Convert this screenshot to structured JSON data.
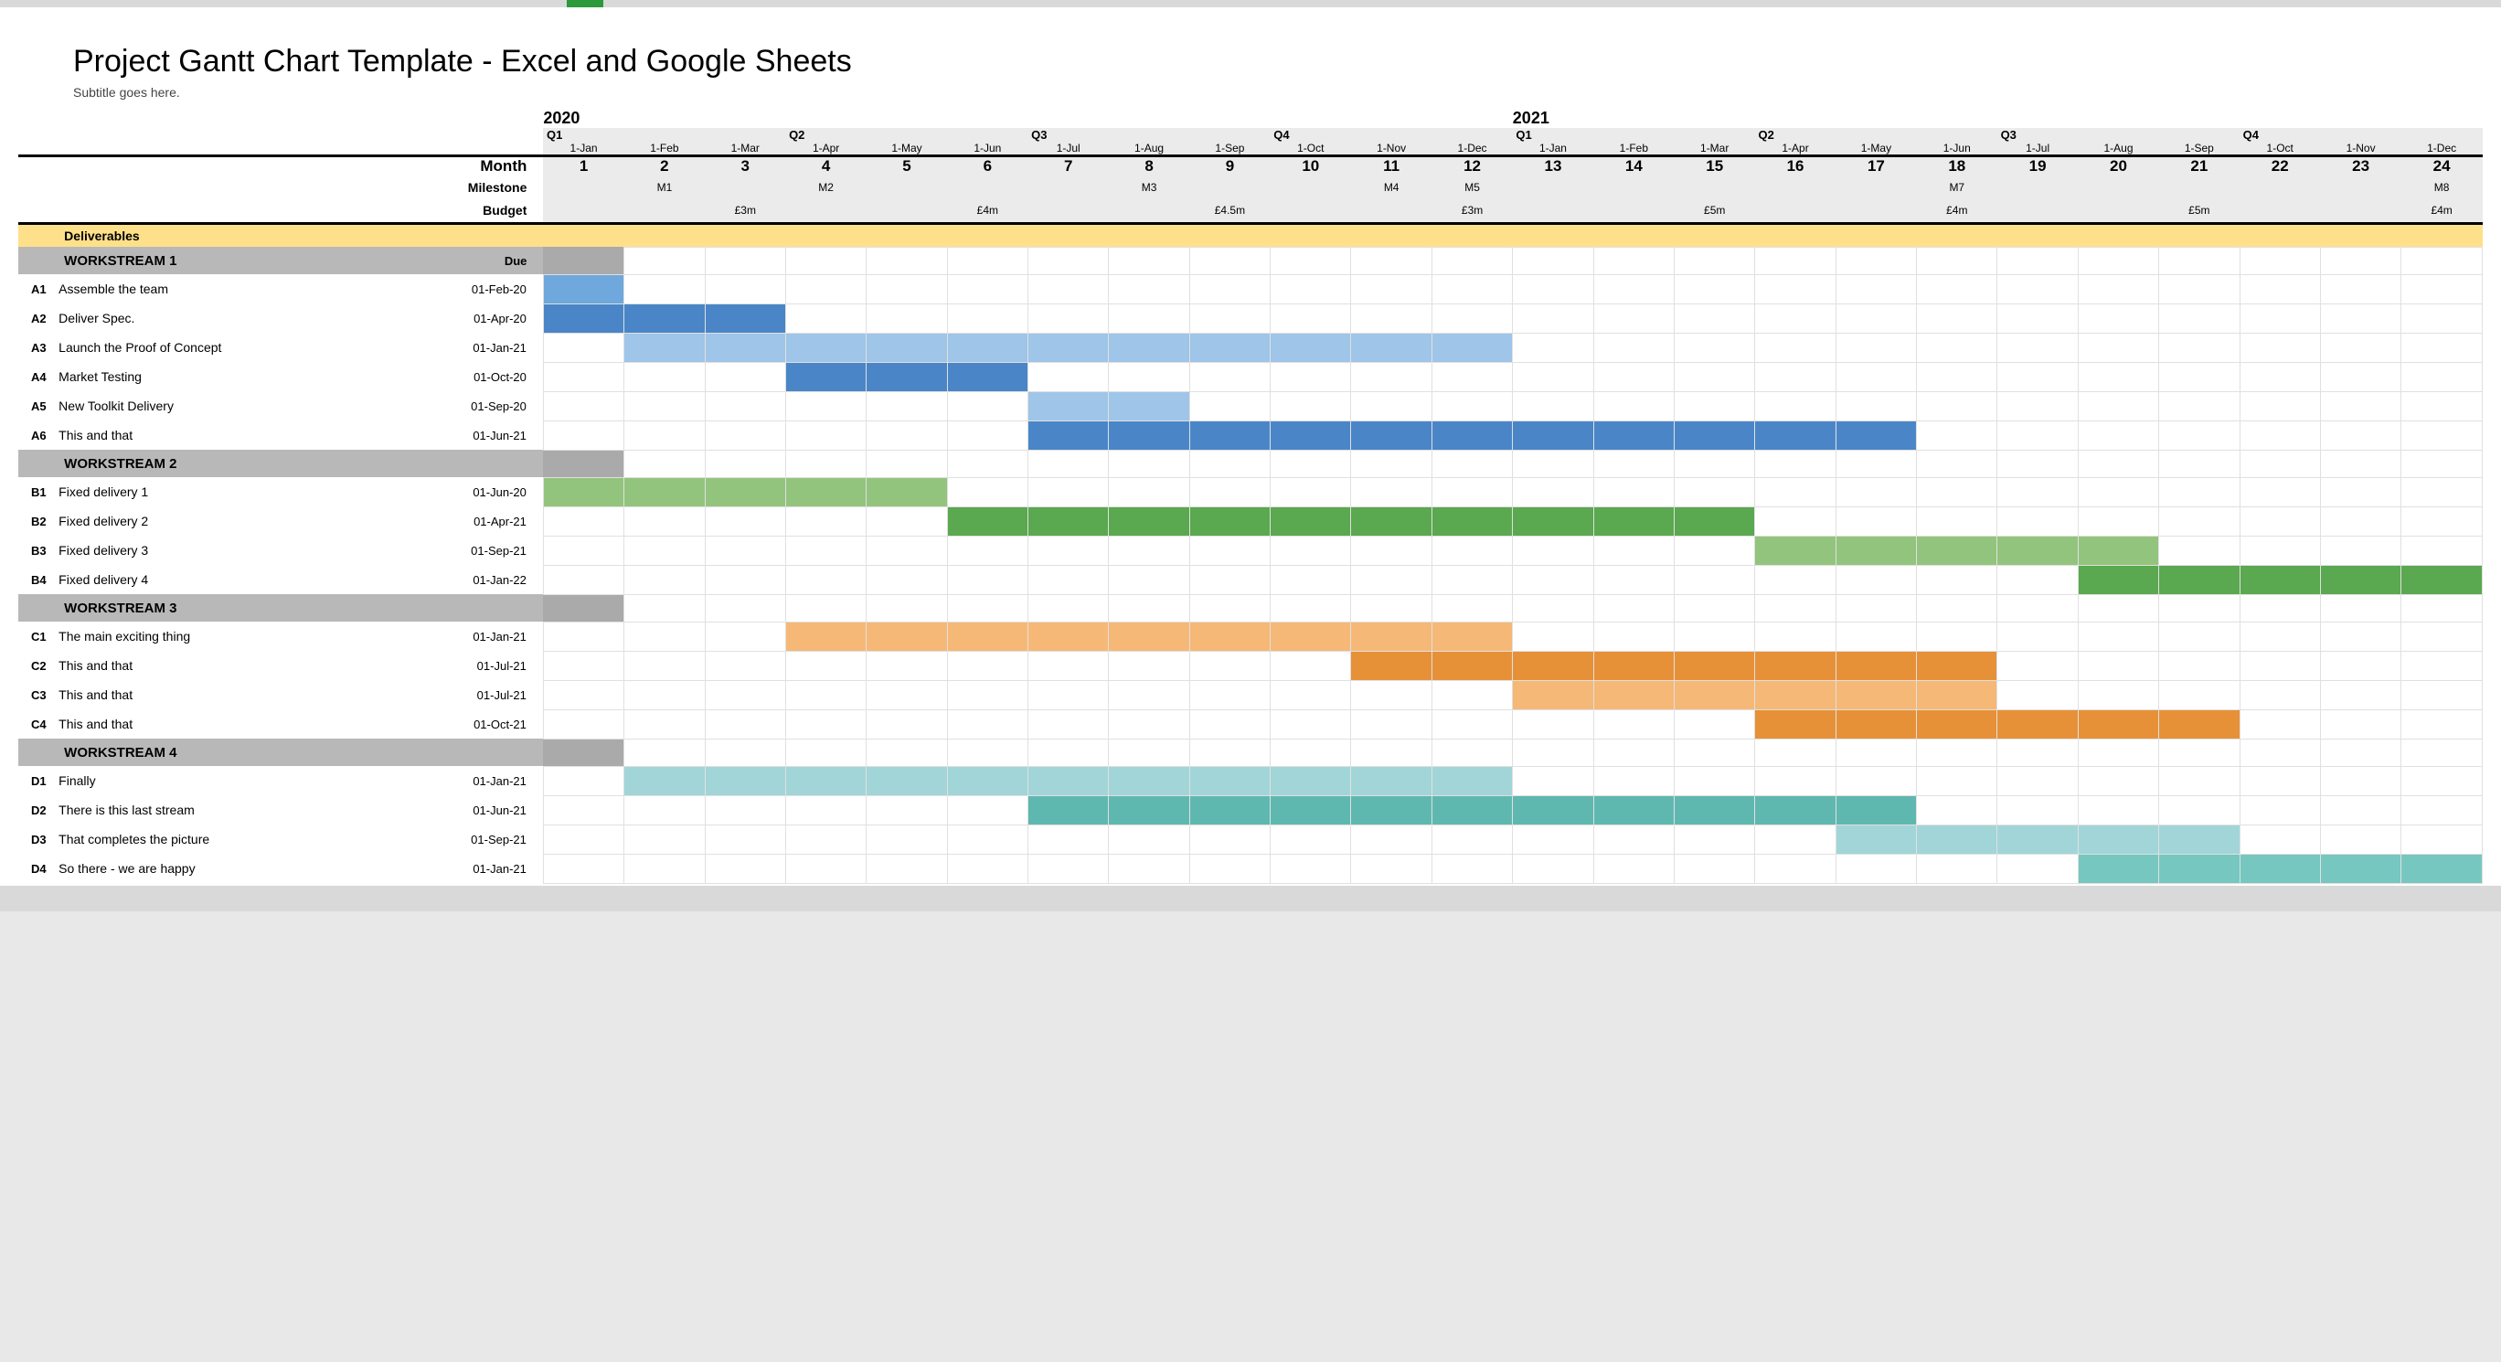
{
  "title": "Project Gantt Chart Template - Excel and Google Sheets",
  "subtitle": "Subtitle goes here.",
  "header": {
    "years": [
      "2020",
      "2021"
    ],
    "quarters": [
      "Q1",
      "Q2",
      "Q3",
      "Q4",
      "Q1",
      "Q2",
      "Q3",
      "Q4"
    ],
    "dates": [
      "1-Jan",
      "1-Feb",
      "1-Mar",
      "1-Apr",
      "1-May",
      "1-Jun",
      "1-Jul",
      "1-Aug",
      "1-Sep",
      "1-Oct",
      "1-Nov",
      "1-Dec",
      "1-Jan",
      "1-Feb",
      "1-Mar",
      "1-Apr",
      "1-May",
      "1-Jun",
      "1-Jul",
      "1-Aug",
      "1-Sep",
      "1-Oct",
      "1-Nov",
      "1-Dec"
    ],
    "nums": [
      "1",
      "2",
      "3",
      "4",
      "5",
      "6",
      "7",
      "8",
      "9",
      "10",
      "11",
      "12",
      "13",
      "14",
      "15",
      "16",
      "17",
      "18",
      "19",
      "20",
      "21",
      "22",
      "23",
      "24"
    ],
    "month_label": "Month",
    "milestone_label": "Milestone",
    "budget_label": "Budget",
    "deliverables_label": "Deliverables",
    "due_label": "Due",
    "milestones": {
      "2": "M1",
      "4": "M2",
      "8": "M3",
      "11": "M4",
      "12": "M5",
      "18": "M7",
      "24": "M8"
    },
    "budgets": {
      "3": "£3m",
      "6": "£4m",
      "9": "£4.5m",
      "12": "£3m",
      "15": "£5m",
      "18": "£4m",
      "21": "£5m",
      "24": "£4m"
    }
  },
  "chart_data": {
    "type": "gantt",
    "x_axis": {
      "unit": "month",
      "start": "2020-01",
      "end": "2021-12",
      "ticks": 24
    },
    "workstreams": [
      {
        "name": "WORKSTREAM 1",
        "tasks": [
          {
            "id": "A1",
            "name": "Assemble the team",
            "due": "01-Feb-20",
            "bar": [
              1,
              1
            ],
            "color": "blue-m"
          },
          {
            "id": "A2",
            "name": "Deliver Spec.",
            "due": "01-Apr-20",
            "bar": [
              1,
              3
            ],
            "color": "blue-d"
          },
          {
            "id": "A3",
            "name": "Launch the Proof of Concept",
            "due": "01-Jan-21",
            "bar": [
              2,
              12
            ],
            "color": "blue-l"
          },
          {
            "id": "A4",
            "name": "Market Testing",
            "due": "01-Oct-20",
            "bar": [
              4,
              6
            ],
            "color": "blue-d"
          },
          {
            "id": "A5",
            "name": "New Toolkit Delivery",
            "due": "01-Sep-20",
            "bar": [
              7,
              8
            ],
            "color": "blue-l"
          },
          {
            "id": "A6",
            "name": "This and that",
            "due": "01-Jun-21",
            "bar": [
              7,
              17
            ],
            "color": "blue-d"
          }
        ]
      },
      {
        "name": "WORKSTREAM 2",
        "tasks": [
          {
            "id": "B1",
            "name": "Fixed delivery 1",
            "due": "01-Jun-20",
            "bar": [
              1,
              5
            ],
            "color": "green-l"
          },
          {
            "id": "B2",
            "name": "Fixed delivery 2",
            "due": "01-Apr-21",
            "bar": [
              6,
              15
            ],
            "color": "green-d"
          },
          {
            "id": "B3",
            "name": "Fixed delivery 3",
            "due": "01-Sep-21",
            "bar": [
              16,
              20
            ],
            "color": "green-l"
          },
          {
            "id": "B4",
            "name": "Fixed delivery 4",
            "due": "01-Jan-22",
            "bar": [
              20,
              24
            ],
            "color": "green-d"
          }
        ]
      },
      {
        "name": "WORKSTREAM 3",
        "tasks": [
          {
            "id": "C1",
            "name": "The main exciting thing",
            "due": "01-Jan-21",
            "bar": [
              4,
              12
            ],
            "color": "orange-l"
          },
          {
            "id": "C2",
            "name": "This and that",
            "due": "01-Jul-21",
            "bar": [
              11,
              18
            ],
            "color": "orange-d"
          },
          {
            "id": "C3",
            "name": "This and that",
            "due": "01-Jul-21",
            "bar": [
              13,
              18
            ],
            "color": "orange-l"
          },
          {
            "id": "C4",
            "name": "This and that",
            "due": "01-Oct-21",
            "bar": [
              16,
              21
            ],
            "color": "orange-d"
          }
        ]
      },
      {
        "name": "WORKSTREAM 4",
        "tasks": [
          {
            "id": "D1",
            "name": "Finally",
            "due": "01-Jan-21",
            "bar": [
              2,
              12
            ],
            "color": "teal-l"
          },
          {
            "id": "D2",
            "name": "There is this last stream",
            "due": "01-Jun-21",
            "bar": [
              7,
              17
            ],
            "color": "teal-d"
          },
          {
            "id": "D3",
            "name": "That completes the picture",
            "due": "01-Sep-21",
            "bar": [
              17,
              21
            ],
            "color": "teal-l"
          },
          {
            "id": "D4",
            "name": "So there - we are happy",
            "due": "01-Jan-21",
            "bar": [
              20,
              24
            ],
            "color": "teal-m"
          }
        ]
      }
    ]
  }
}
